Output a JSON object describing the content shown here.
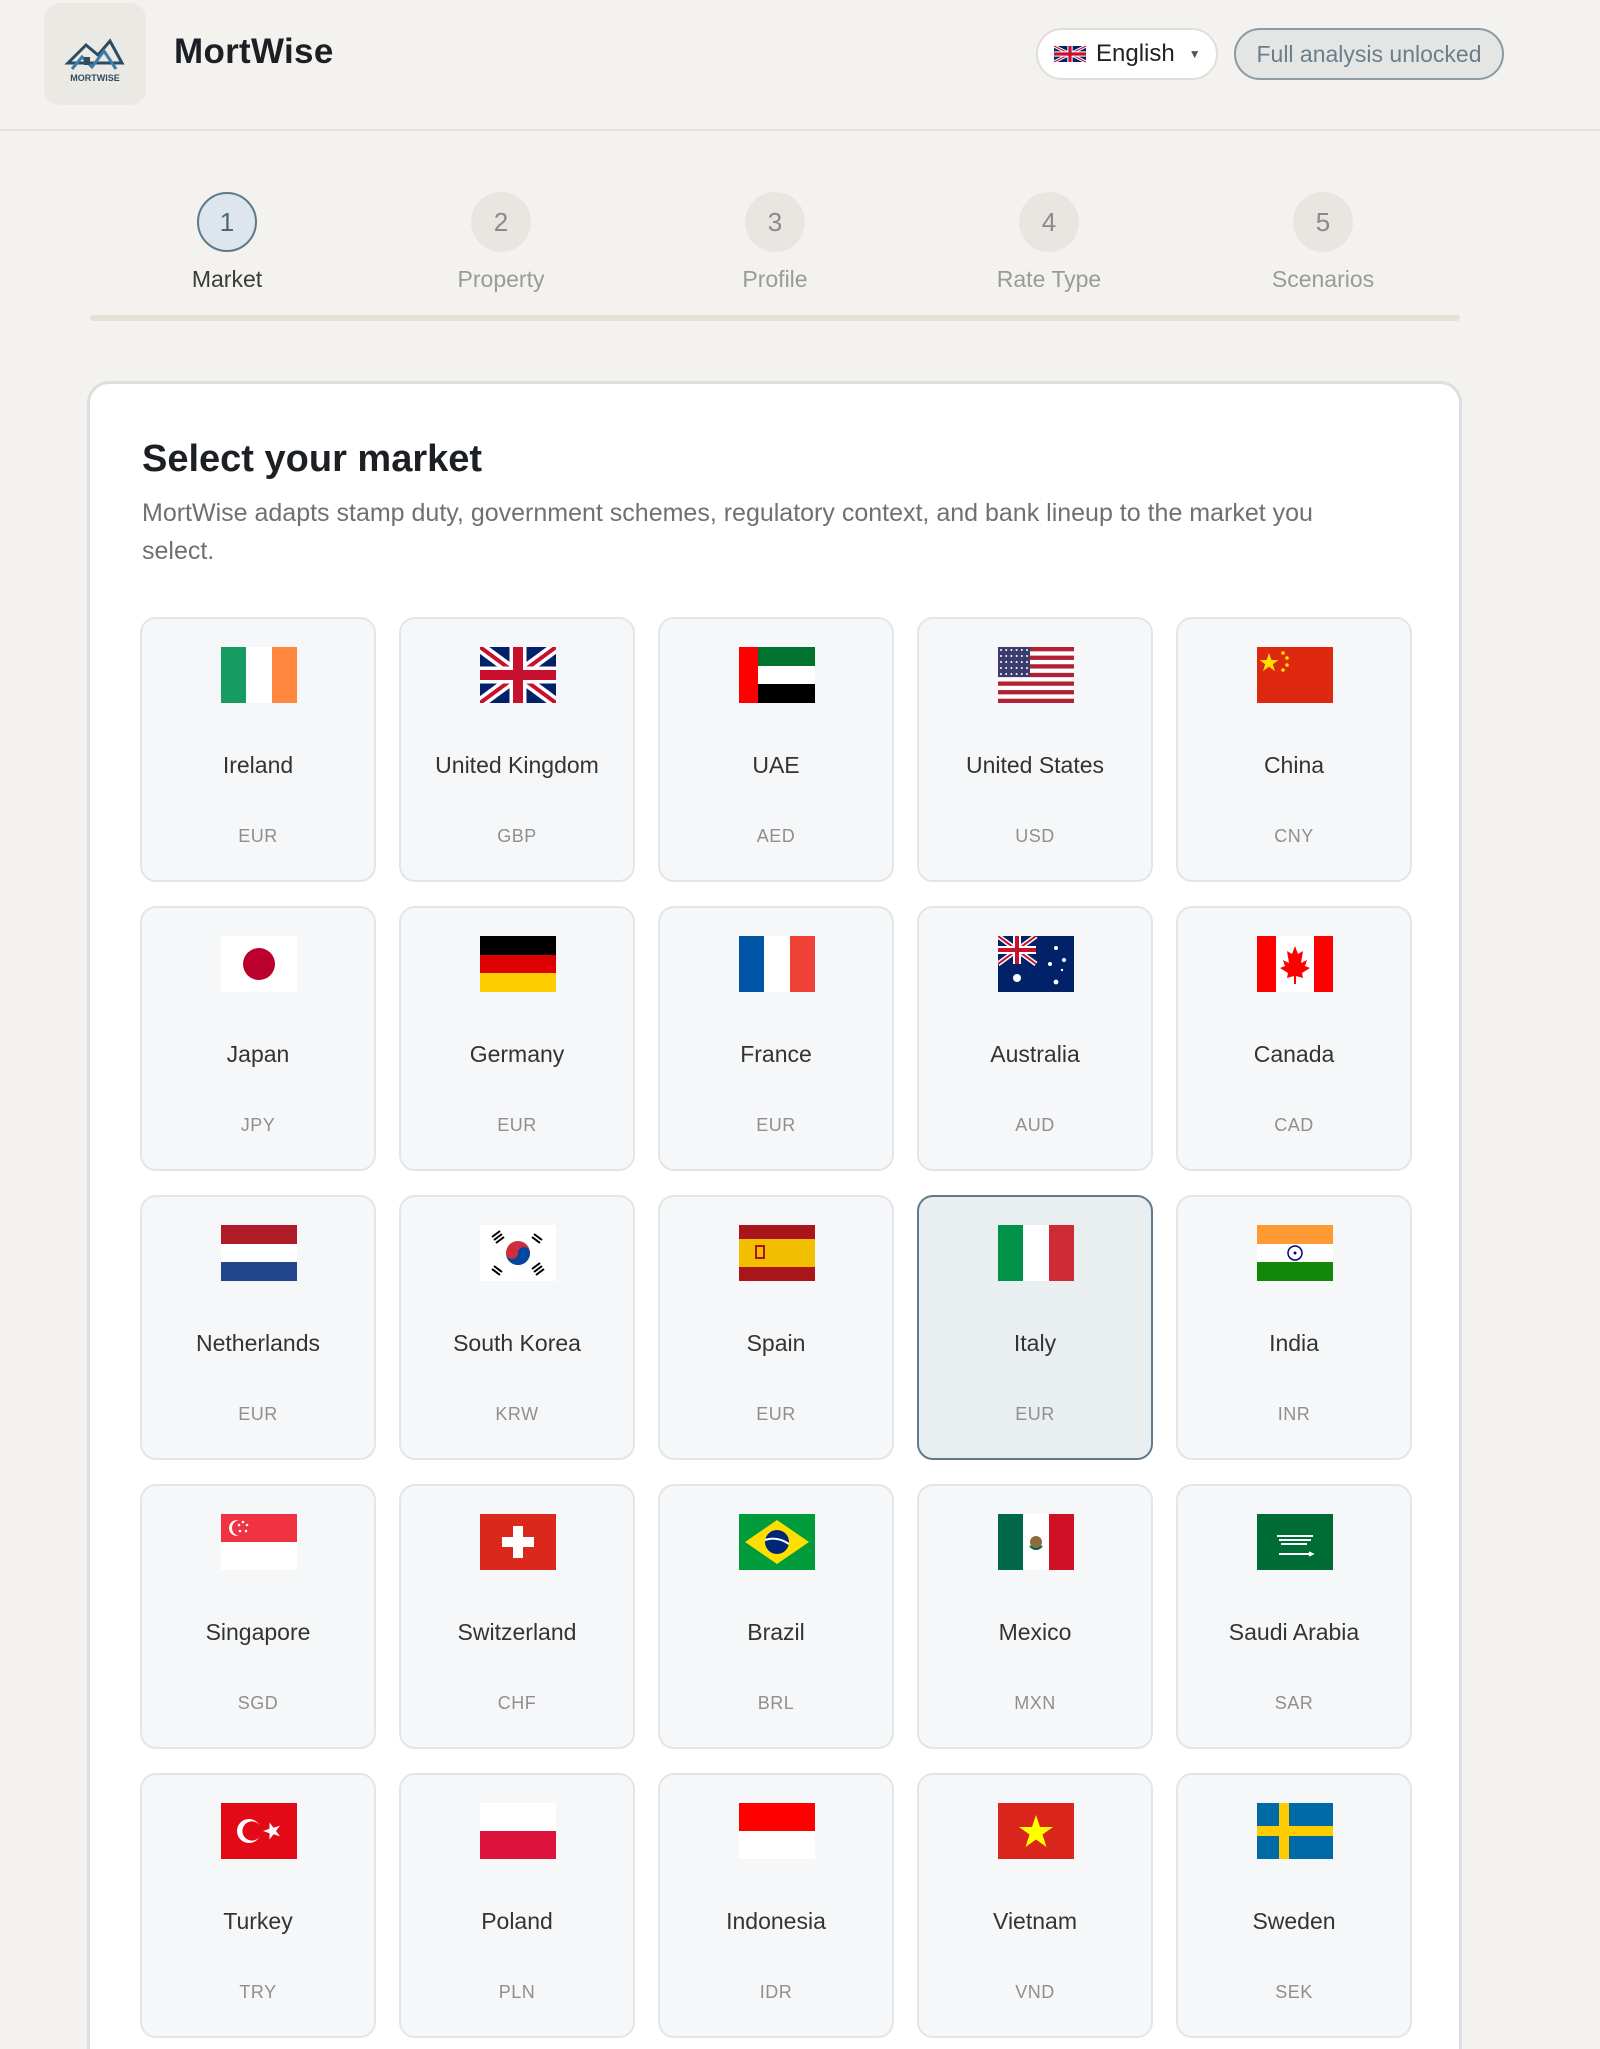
{
  "app": {
    "name": "MortWise",
    "logo_text": "MORTWISE"
  },
  "header": {
    "language": {
      "label": "English",
      "flag": "uk-flag-icon"
    },
    "status_badge": "Full analysis unlocked"
  },
  "stepper": {
    "active_index": 0,
    "steps": [
      {
        "number": "1",
        "label": "Market"
      },
      {
        "number": "2",
        "label": "Property"
      },
      {
        "number": "3",
        "label": "Profile"
      },
      {
        "number": "4",
        "label": "Rate Type"
      },
      {
        "number": "5",
        "label": "Scenarios"
      }
    ]
  },
  "market": {
    "title": "Select your market",
    "description": "MortWise adapts stamp duty, government schemes, regulatory context, and bank lineup to the market you select.",
    "selected": "Italy",
    "countries": [
      {
        "name": "Ireland",
        "currency": "EUR",
        "flag": "ie"
      },
      {
        "name": "United Kingdom",
        "currency": "GBP",
        "flag": "gb"
      },
      {
        "name": "UAE",
        "currency": "AED",
        "flag": "ae"
      },
      {
        "name": "United States",
        "currency": "USD",
        "flag": "us"
      },
      {
        "name": "China",
        "currency": "CNY",
        "flag": "cn"
      },
      {
        "name": "Japan",
        "currency": "JPY",
        "flag": "jp"
      },
      {
        "name": "Germany",
        "currency": "EUR",
        "flag": "de"
      },
      {
        "name": "France",
        "currency": "EUR",
        "flag": "fr"
      },
      {
        "name": "Australia",
        "currency": "AUD",
        "flag": "au"
      },
      {
        "name": "Canada",
        "currency": "CAD",
        "flag": "ca"
      },
      {
        "name": "Netherlands",
        "currency": "EUR",
        "flag": "nl"
      },
      {
        "name": "South Korea",
        "currency": "KRW",
        "flag": "kr"
      },
      {
        "name": "Spain",
        "currency": "EUR",
        "flag": "es"
      },
      {
        "name": "Italy",
        "currency": "EUR",
        "flag": "it"
      },
      {
        "name": "India",
        "currency": "INR",
        "flag": "in"
      },
      {
        "name": "Singapore",
        "currency": "SGD",
        "flag": "sg"
      },
      {
        "name": "Switzerland",
        "currency": "CHF",
        "flag": "ch"
      },
      {
        "name": "Brazil",
        "currency": "BRL",
        "flag": "br"
      },
      {
        "name": "Mexico",
        "currency": "MXN",
        "flag": "mx"
      },
      {
        "name": "Saudi Arabia",
        "currency": "SAR",
        "flag": "sa"
      },
      {
        "name": "Turkey",
        "currency": "TRY",
        "flag": "tr"
      },
      {
        "name": "Poland",
        "currency": "PLN",
        "flag": "pl"
      },
      {
        "name": "Indonesia",
        "currency": "IDR",
        "flag": "id"
      },
      {
        "name": "Vietnam",
        "currency": "VND",
        "flag": "vn"
      },
      {
        "name": "Sweden",
        "currency": "SEK",
        "flag": "se"
      }
    ]
  }
}
